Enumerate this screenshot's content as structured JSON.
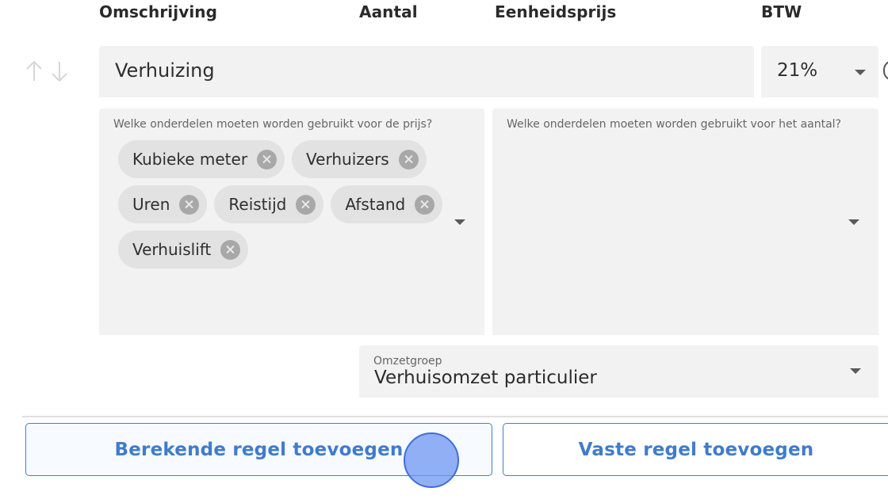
{
  "headers": {
    "description": "Omschrijving",
    "quantity": "Aantal",
    "unit_price": "Eenheidsprijs",
    "vat": "BTW"
  },
  "row": {
    "description": "Verhuizing",
    "vat": "21%"
  },
  "price_components": {
    "label": "Welke onderdelen moeten worden gebruikt voor de prijs?",
    "chips": [
      "Kubieke meter",
      "Verhuizers",
      "Uren",
      "Reistijd",
      "Afstand",
      "Verhuislift"
    ]
  },
  "quantity_components": {
    "label": "Welke onderdelen moeten worden gebruikt voor het aantal?"
  },
  "revenue_group": {
    "label": "Omzetgroep",
    "value": "Verhuisomzet particulier"
  },
  "buttons": {
    "add_calculated": "Berekende regel toevoegen",
    "add_fixed": "Vaste regel toevoegen"
  },
  "icons": {
    "move_up": "arrow-up-icon",
    "move_down": "arrow-down-icon",
    "chip_remove": "close-circle-icon",
    "dropdown": "caret-down-icon"
  },
  "colors": {
    "accent": "#3f7ccb",
    "field_bg": "#f2f2f2",
    "chip_bg": "#e2e2e2"
  }
}
